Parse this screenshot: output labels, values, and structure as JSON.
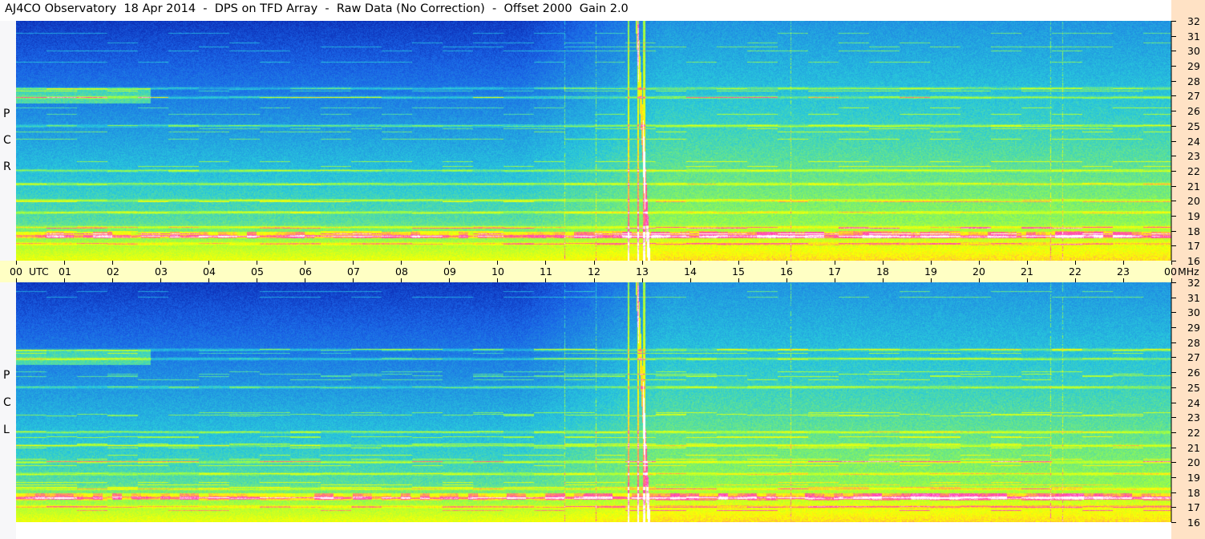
{
  "title": "AJ4CO Observatory  18 Apr 2014  -  DPS on TFD Array  -  Raw Data (No Correction)  -  Offset 2000  Gain 2.0",
  "time_axis": {
    "labels": [
      "00",
      "UTC",
      "01",
      "02",
      "03",
      "04",
      "05",
      "06",
      "07",
      "08",
      "09",
      "10",
      "11",
      "12",
      "13",
      "14",
      "15",
      "16",
      "17",
      "18",
      "19",
      "20",
      "21",
      "22",
      "23",
      "00",
      "MHz"
    ]
  },
  "panels": [
    {
      "letters": [
        "P",
        "C",
        "R"
      ]
    },
    {
      "letters": [
        "P",
        "C",
        "L"
      ]
    }
  ],
  "colors": {
    "low": "#00008c",
    "mid_low": "#1a64e6",
    "mid": "#28c8dc",
    "mid_high": "#a0ff40",
    "high": "#ffff00",
    "peak": "#ff3cb4",
    "max": "#ffffff",
    "time_bar_bg": "#ffffc4",
    "freq_bar_bg": "#ffe2c5"
  },
  "chart_data": [
    {
      "type": "heatmap",
      "polarization": "RCP",
      "x_axis": {
        "unit": "UTC hour",
        "range": [
          0,
          24
        ],
        "ticks": [
          "00",
          "01",
          "02",
          "03",
          "04",
          "05",
          "06",
          "07",
          "08",
          "09",
          "10",
          "11",
          "12",
          "13",
          "14",
          "15",
          "16",
          "17",
          "18",
          "19",
          "20",
          "21",
          "22",
          "23",
          "00"
        ]
      },
      "y_axis": {
        "unit": "MHz",
        "range": [
          16,
          32
        ],
        "ticks": [
          16,
          17,
          18,
          19,
          20,
          21,
          22,
          23,
          24,
          25,
          26,
          27,
          28,
          29,
          30,
          31,
          32
        ]
      },
      "colormap": [
        "#00008c",
        "#1a64e6",
        "#28c8dc",
        "#a0ff40",
        "#ffff00",
        "#ff3cb4",
        "#ffffff"
      ],
      "features": {
        "strong_bands_mhz": [
          17.1,
          17.6,
          18.2,
          19.2,
          20.0,
          21.1,
          22.0,
          25.0,
          26.9,
          27.5
        ],
        "vertical_bursts_utc": [
          12.72,
          12.92,
          13.05
        ],
        "drifting_stripe": {
          "utc_at_32mhz": 12.9,
          "utc_at_16mhz": 13.15
        },
        "interference_columns_utc": [
          11.4,
          12.05,
          16.1,
          21.5,
          21.75
        ]
      }
    },
    {
      "type": "heatmap",
      "polarization": "LCP",
      "x_axis": {
        "unit": "UTC hour",
        "range": [
          0,
          24
        ],
        "ticks": [
          "00",
          "01",
          "02",
          "03",
          "04",
          "05",
          "06",
          "07",
          "08",
          "09",
          "10",
          "11",
          "12",
          "13",
          "14",
          "15",
          "16",
          "17",
          "18",
          "19",
          "20",
          "21",
          "22",
          "23",
          "00"
        ]
      },
      "y_axis": {
        "unit": "MHz",
        "range": [
          16,
          32
        ],
        "ticks": [
          16,
          17,
          18,
          19,
          20,
          21,
          22,
          23,
          24,
          25,
          26,
          27,
          28,
          29,
          30,
          31,
          32
        ]
      },
      "colormap": [
        "#00008c",
        "#1a64e6",
        "#28c8dc",
        "#a0ff40",
        "#ffff00",
        "#ff3cb4",
        "#ffffff"
      ],
      "features": {
        "strong_bands_mhz": [
          17.0,
          17.6,
          18.2,
          19.2,
          20.0,
          21.1,
          22.0,
          25.0,
          26.9,
          27.5
        ],
        "vertical_bursts_utc": [
          12.72,
          12.92,
          13.05
        ],
        "drifting_stripe": {
          "utc_at_32mhz": 12.9,
          "utc_at_16mhz": 13.15
        },
        "interference_columns_utc": [
          11.4,
          12.05,
          16.1,
          21.5,
          21.75
        ]
      }
    }
  ]
}
